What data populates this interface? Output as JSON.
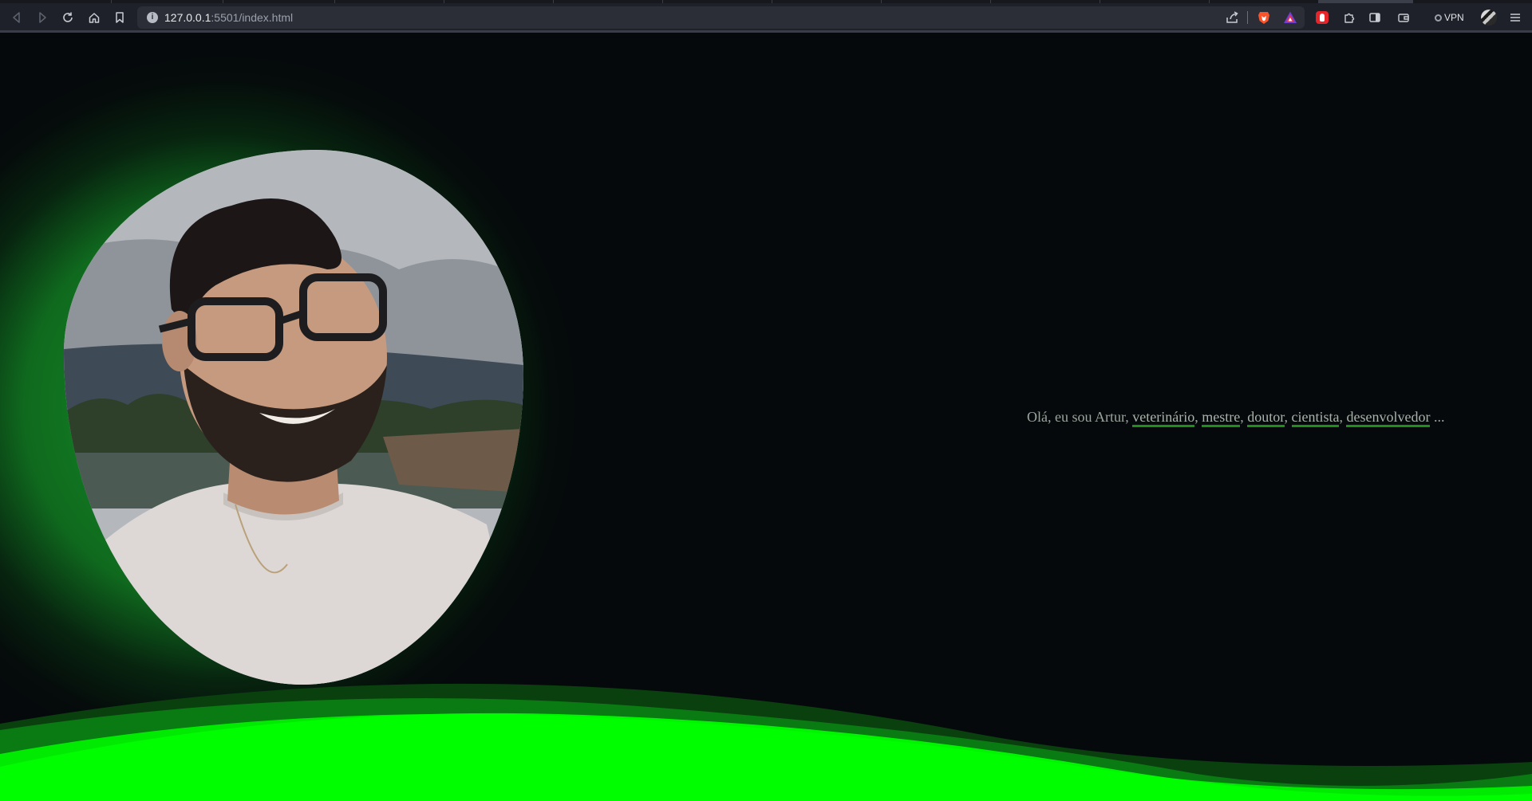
{
  "browser": {
    "url_host": "127.0.0.1",
    "url_path": ":5501/index.html",
    "vpn_label": "VPN",
    "icons": {
      "back": "back-arrow-icon",
      "forward": "forward-arrow-icon",
      "reload": "reload-icon",
      "home": "home-icon",
      "bookmark": "bookmark-icon",
      "site_info": "site-info-icon",
      "share": "share-icon",
      "brave_shields": "brave-lion-icon",
      "brave_rewards": "brave-rewards-icon",
      "extension_red": "red-extension-icon",
      "extensions": "puzzle-icon",
      "sidebar": "sidebar-icon",
      "wallet": "wallet-icon",
      "menu": "hamburger-menu-icon"
    }
  },
  "hero": {
    "greeting": "Olá, eu sou Artur, ",
    "roles": [
      "veterinário",
      "mestre",
      "doutor",
      "cientista",
      "desenvolvedor"
    ],
    "separator": ", ",
    "trailing": " ..."
  },
  "colors": {
    "background": "#05090b",
    "accent_green": "#00ff00",
    "dark_green": "#0a3a10",
    "underline_green": "#1f8f1a",
    "text": "#9ba49d"
  }
}
